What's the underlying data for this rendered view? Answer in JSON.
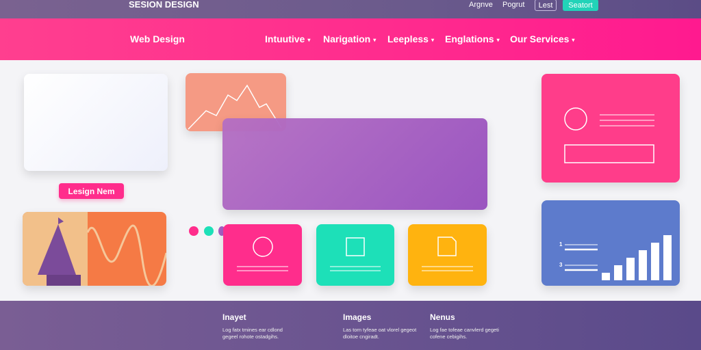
{
  "header": {
    "brand": "SESION DESIGN",
    "links": [
      "Argnve",
      "Pogrut"
    ],
    "login_label": "Lest",
    "signup_label": "Seatort"
  },
  "nav": {
    "title": "Web Design",
    "items": [
      {
        "label": "Intuutive"
      },
      {
        "label": "Narigation"
      },
      {
        "label": "Leepless"
      },
      {
        "label": "Englations"
      },
      {
        "label": "Our Services"
      }
    ],
    "caret": "▾"
  },
  "main": {
    "button_label": "Lesign Nem",
    "chart_labels": [
      "1",
      "3"
    ],
    "bar_levels": [
      1,
      2,
      3,
      4,
      5,
      6
    ]
  },
  "colors": {
    "pink": "#ff3d8f",
    "teal": "#1de0b8",
    "purple": "#a55dc2",
    "orange": "#ffb30f",
    "blue": "#5d7bcc",
    "salmon": "#f59a84"
  },
  "footer": {
    "columns": [
      {
        "title": "Inayet",
        "text": "Log fatx tmines ear cdlond gegeel rohote ostadgihs."
      },
      {
        "title": "Images",
        "text": "Las torn tyfeae oat vlorel gegeot dloitoe cngiradt."
      },
      {
        "title": "Nenus",
        "text": "Log fae tofeae canvlerd gegeti cofene cebigihs."
      }
    ]
  }
}
